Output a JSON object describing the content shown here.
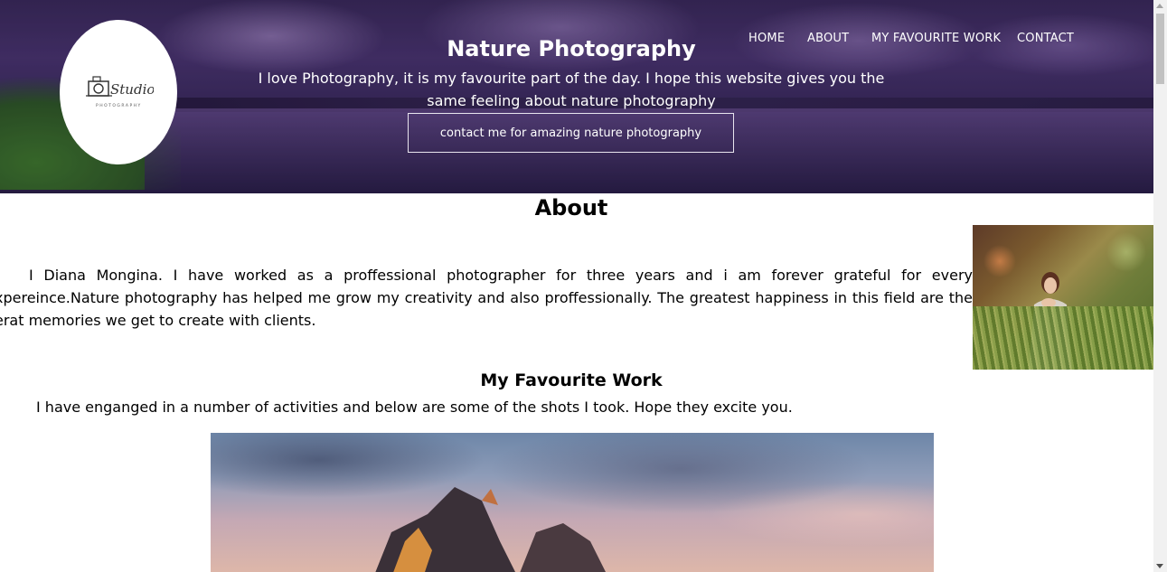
{
  "nav": {
    "items": [
      {
        "label": "HOME"
      },
      {
        "label": "ABOUT"
      },
      {
        "label": "MY FAVOURITE WORK"
      },
      {
        "label": "CONTACT"
      }
    ]
  },
  "hero": {
    "title": "Nature Photography",
    "text": "I love Photography, it is my favourite part of the day. I hope this website gives you the same feeling about nature photography",
    "button_label": "contact me for amazing nature photography",
    "logo_text": "Studio",
    "logo_subtext": "PHOTOGRAPHY"
  },
  "about": {
    "title": "About",
    "text": "I Diana Mongina. I have worked as a proffessional photographer for three years and i am forever grateful for every xpereince.Nature photography has helped me grow my creativity and also proffessionally. The greatest happiness in this field are the erat memories we get to create with clients."
  },
  "favourite": {
    "title": "My Favourite Work",
    "text": "I have enganged in a number of activities and below are some of the shots I took. Hope they excite you."
  },
  "colors": {
    "hero_overlay": "#3a2a5a",
    "text": "#000000",
    "nav_text": "#ffffff",
    "scrollbar_thumb": "#c1c1c1"
  }
}
